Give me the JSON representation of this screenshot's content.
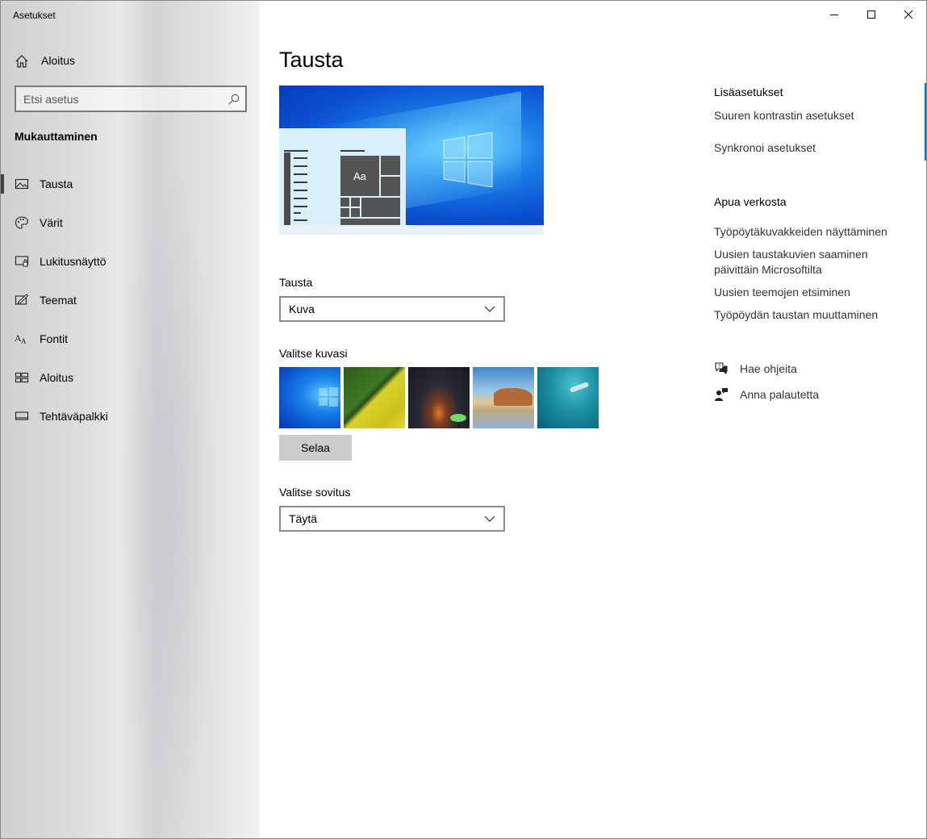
{
  "window": {
    "title": "Asetukset"
  },
  "sidebar": {
    "home_label": "Aloitus",
    "search_placeholder": "Etsi asetus",
    "section_title": "Mukauttaminen",
    "items": [
      {
        "label": "Tausta",
        "icon": "picture-icon",
        "selected": true
      },
      {
        "label": "Värit",
        "icon": "palette-icon",
        "selected": false
      },
      {
        "label": "Lukitusnäyttö",
        "icon": "lock-screen-icon",
        "selected": false
      },
      {
        "label": "Teemat",
        "icon": "themes-icon",
        "selected": false
      },
      {
        "label": "Fontit",
        "icon": "fonts-icon",
        "selected": false
      },
      {
        "label": "Aloitus",
        "icon": "start-icon",
        "selected": false
      },
      {
        "label": "Tehtäväpalkki",
        "icon": "taskbar-icon",
        "selected": false
      }
    ]
  },
  "main": {
    "title": "Tausta",
    "preview_tile_text": "Aa",
    "background_label": "Tausta",
    "background_value": "Kuva",
    "choose_picture_label": "Valitse kuvasi",
    "browse_label": "Selaa",
    "fit_label": "Valitse sovitus",
    "fit_value": "Täytä"
  },
  "right": {
    "related_heading": "Lisäasetukset",
    "related_links": [
      "Suuren kontrastin asetukset",
      "Synkronoi asetukset"
    ],
    "help_heading": "Apua verkosta",
    "help_links": [
      "Työpöytäkuvakkeiden näyttäminen",
      "Uusien taustakuvien saaminen päivittäin Microsoftilta",
      "Uusien teemojen etsiminen",
      "Työpöydän taustan muuttaminen"
    ],
    "get_help": "Hae ohjeita",
    "give_feedback": "Anna palautetta"
  },
  "colors": {
    "accent": "#0078d7",
    "selection_bar": "#444444"
  }
}
